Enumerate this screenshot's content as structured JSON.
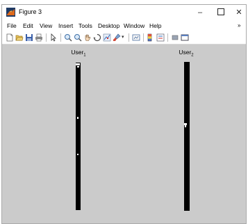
{
  "window": {
    "title": "Figure 3",
    "controls": {
      "minimize": "–",
      "close": "✕"
    }
  },
  "menu": {
    "items": [
      "File",
      "Edit",
      "View",
      "Insert",
      "Tools",
      "Desktop",
      "Window",
      "Help"
    ],
    "overflow": "»"
  },
  "plot": {
    "left_title": "User",
    "left_subscript": "1",
    "right_title": "User",
    "right_subscript": "2",
    "background": "#cbcbcb",
    "bar_color": "#000000"
  }
}
